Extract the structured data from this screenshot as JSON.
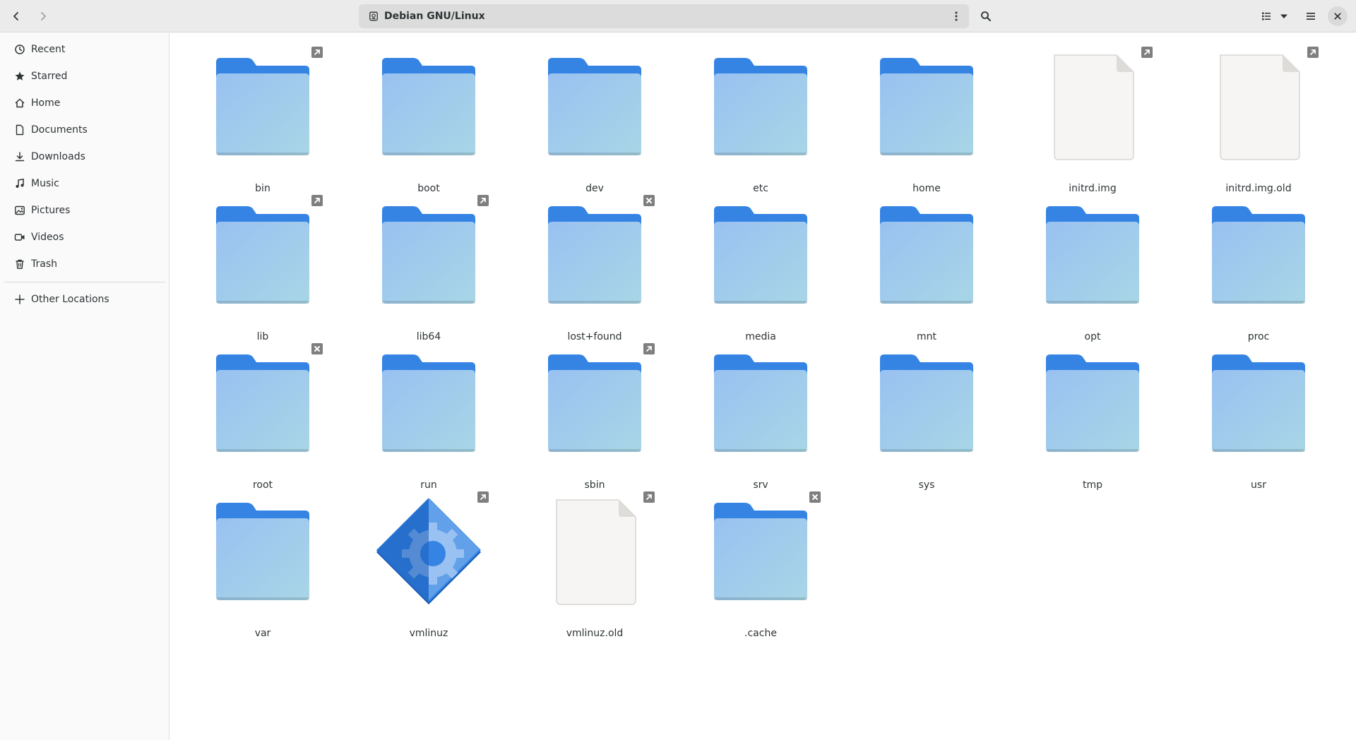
{
  "window": {
    "path_label": "Debian GNU/Linux"
  },
  "toolbar": {
    "back_icon": "go-back-icon",
    "forward_icon": "go-forward-icon",
    "search_icon": "search-icon",
    "view_icon": "list-view-icon",
    "view_options_icon": "chevron-down-icon",
    "menu_icon": "hamburger-menu-icon",
    "close_icon": "close-icon"
  },
  "sidebar": {
    "items": [
      {
        "label": "Recent",
        "icon": "clock-icon"
      },
      {
        "label": "Starred",
        "icon": "star-icon"
      },
      {
        "label": "Home",
        "icon": "home-icon"
      },
      {
        "label": "Documents",
        "icon": "document-icon"
      },
      {
        "label": "Downloads",
        "icon": "download-icon"
      },
      {
        "label": "Music",
        "icon": "music-icon"
      },
      {
        "label": "Pictures",
        "icon": "picture-icon"
      },
      {
        "label": "Videos",
        "icon": "video-icon"
      },
      {
        "label": "Trash",
        "icon": "trash-icon"
      }
    ],
    "other": {
      "label": "Other Locations",
      "icon": "plus-icon"
    }
  },
  "files": [
    {
      "name": "bin",
      "type": "folder",
      "emblem": "symlink"
    },
    {
      "name": "boot",
      "type": "folder",
      "emblem": ""
    },
    {
      "name": "dev",
      "type": "folder",
      "emblem": ""
    },
    {
      "name": "etc",
      "type": "folder",
      "emblem": ""
    },
    {
      "name": "home",
      "type": "folder",
      "emblem": ""
    },
    {
      "name": "initrd.img",
      "type": "file",
      "emblem": "symlink"
    },
    {
      "name": "initrd.img.old",
      "type": "file",
      "emblem": "symlink"
    },
    {
      "name": "lib",
      "type": "folder",
      "emblem": "symlink"
    },
    {
      "name": "lib64",
      "type": "folder",
      "emblem": "symlink"
    },
    {
      "name": "lost+found",
      "type": "folder",
      "emblem": "unreadable"
    },
    {
      "name": "media",
      "type": "folder",
      "emblem": ""
    },
    {
      "name": "mnt",
      "type": "folder",
      "emblem": ""
    },
    {
      "name": "opt",
      "type": "folder",
      "emblem": ""
    },
    {
      "name": "proc",
      "type": "folder",
      "emblem": ""
    },
    {
      "name": "root",
      "type": "folder",
      "emblem": "unreadable"
    },
    {
      "name": "run",
      "type": "folder",
      "emblem": ""
    },
    {
      "name": "sbin",
      "type": "folder",
      "emblem": "symlink"
    },
    {
      "name": "srv",
      "type": "folder",
      "emblem": ""
    },
    {
      "name": "sys",
      "type": "folder",
      "emblem": ""
    },
    {
      "name": "tmp",
      "type": "folder",
      "emblem": ""
    },
    {
      "name": "usr",
      "type": "folder",
      "emblem": ""
    },
    {
      "name": "var",
      "type": "folder",
      "emblem": ""
    },
    {
      "name": "vmlinuz",
      "type": "executable",
      "emblem": "symlink"
    },
    {
      "name": "vmlinuz.old",
      "type": "file",
      "emblem": "symlink"
    },
    {
      "name": ".cache",
      "type": "folder",
      "emblem": "unreadable"
    }
  ],
  "colors": {
    "folder_back": "#3584e4",
    "folder_front_top": "#99c1f1",
    "folder_front_bottom": "#a8d6e6",
    "file_page": "#f6f5f4",
    "emblem_bg": "#7f7f7f"
  }
}
